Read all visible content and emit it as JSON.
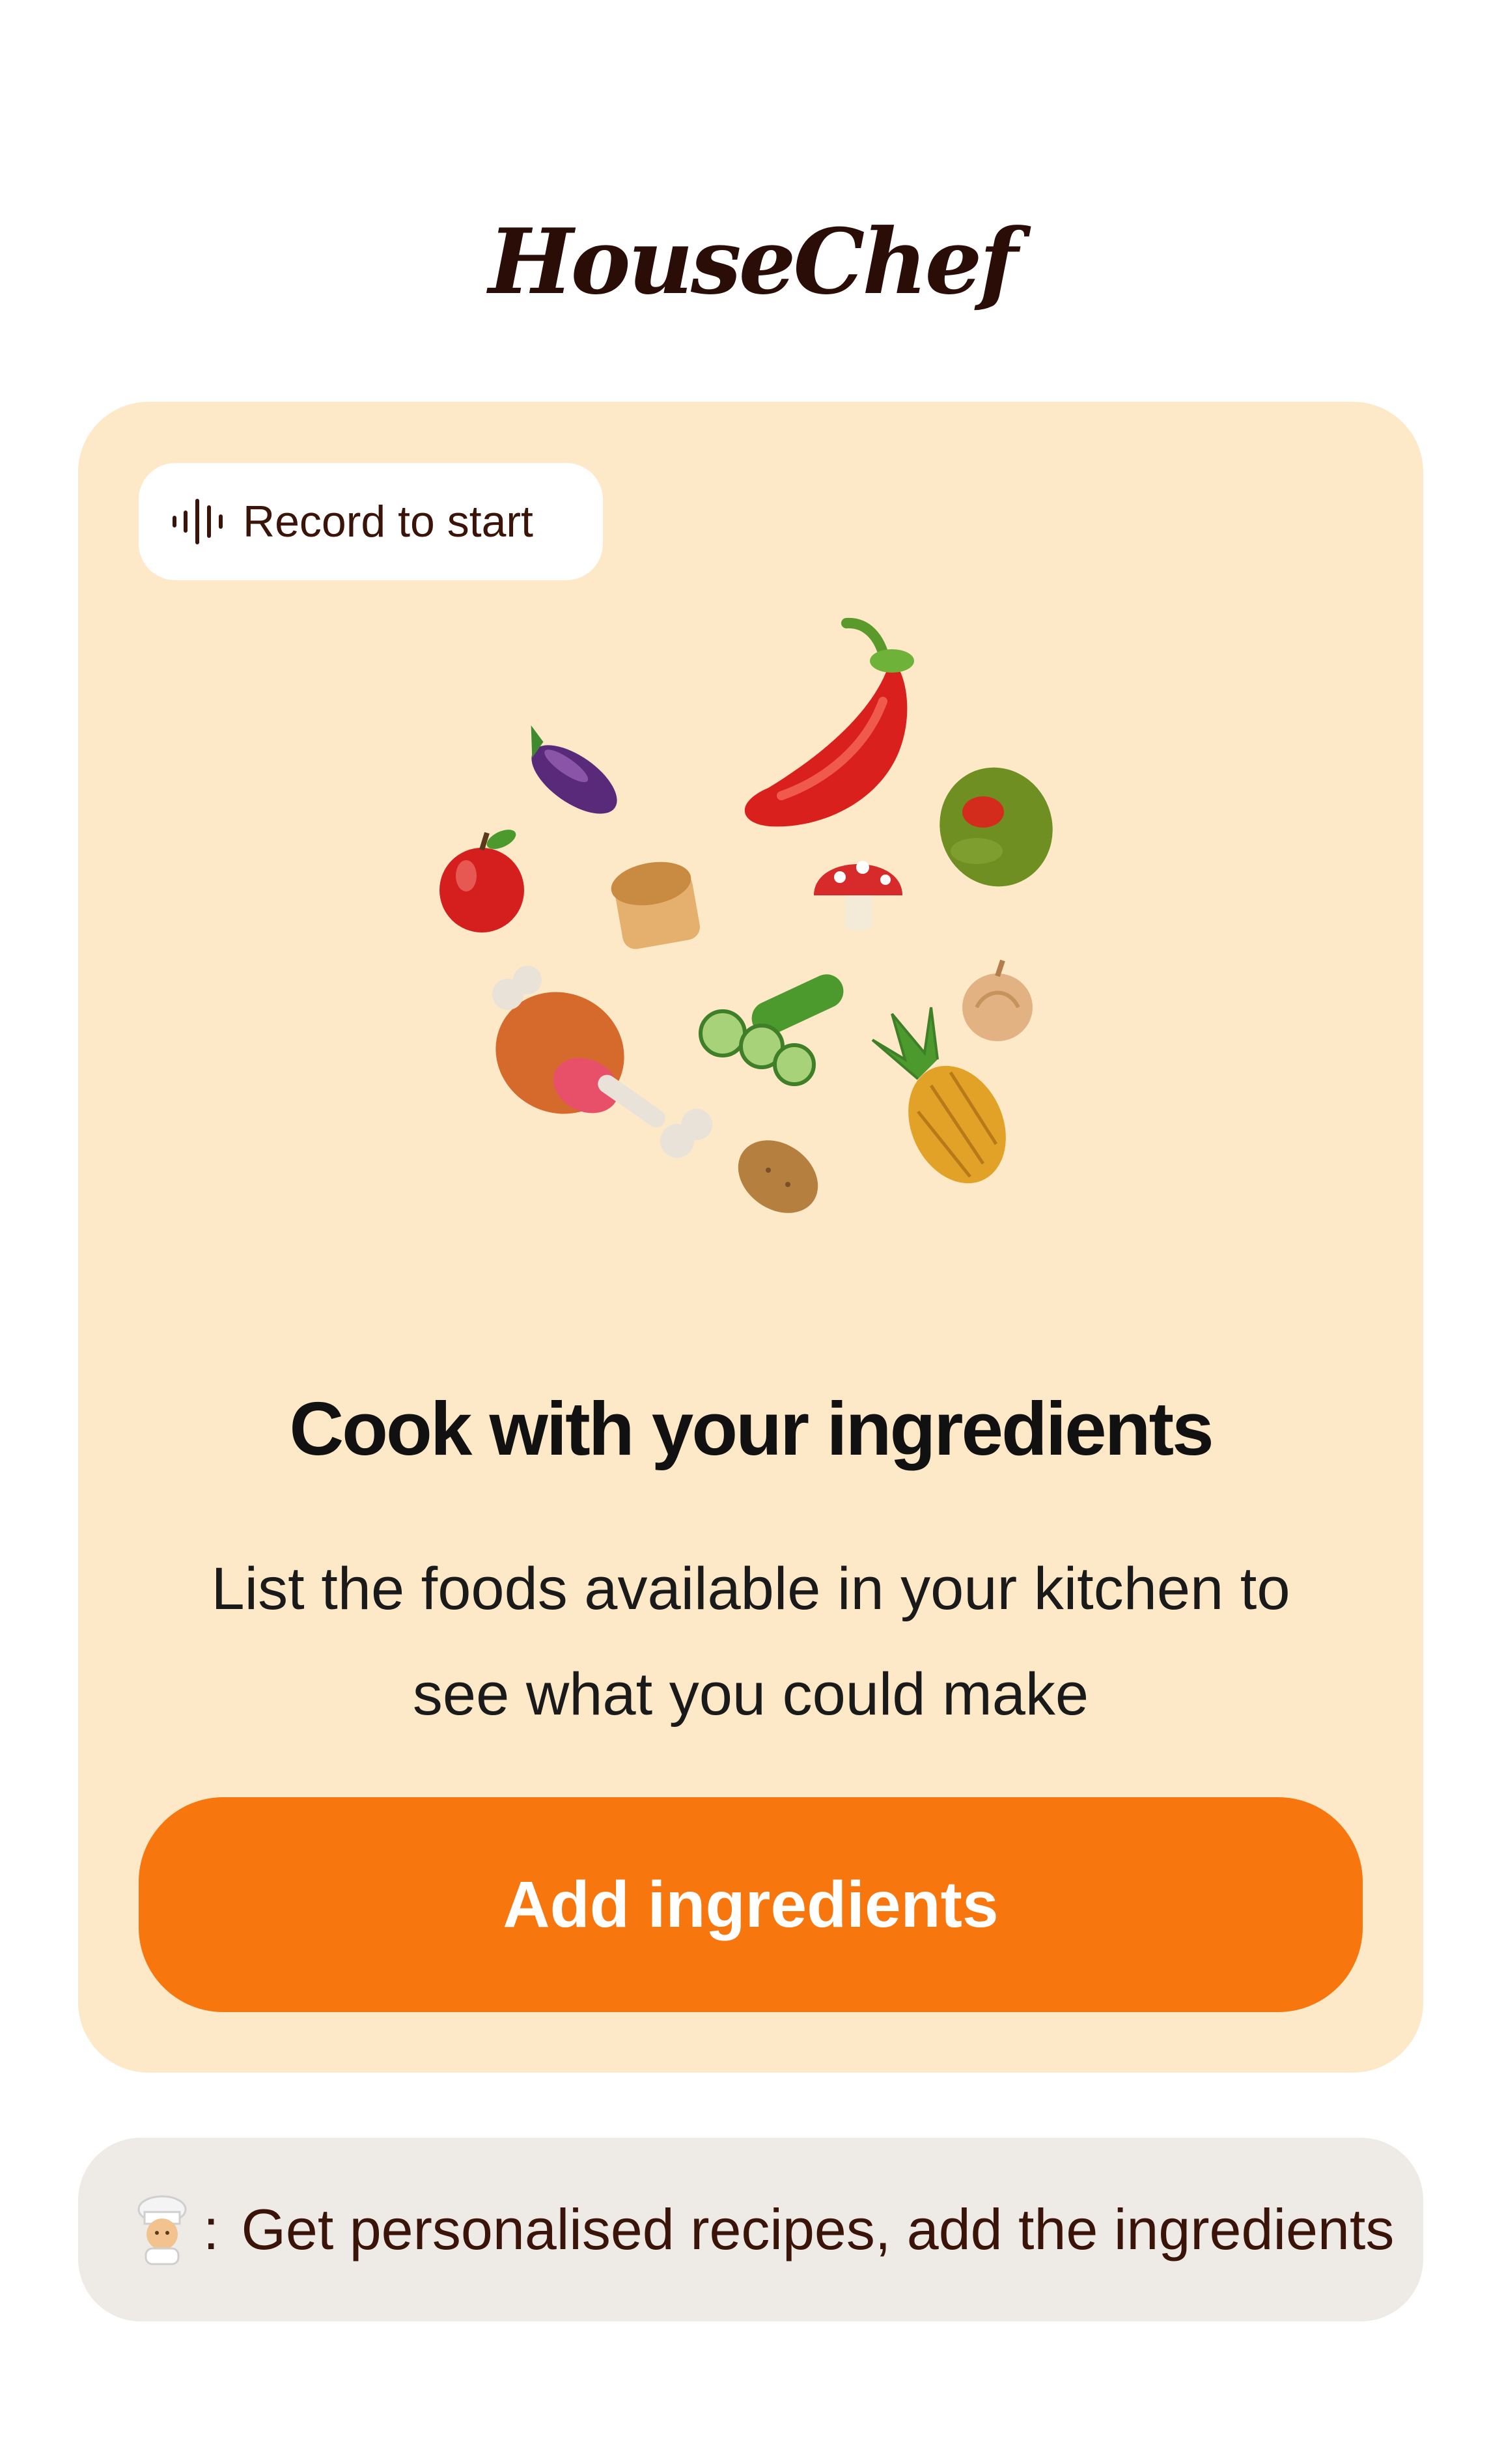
{
  "app": {
    "title": "HouseChef"
  },
  "card": {
    "record_label": "Record to start",
    "heading": "Cook with your ingredients",
    "subtext": "List the foods available in your kitchen to see what you could make",
    "cta_label": "Add ingredients",
    "illustration_items": [
      "chili-pepper",
      "eggplant",
      "olive",
      "apple",
      "bread",
      "mushroom",
      "onion",
      "meat-on-bone",
      "cucumber",
      "pineapple",
      "potato"
    ]
  },
  "hint": {
    "icon": "chef-emoji",
    "separator": ":",
    "text": "Get personalised recipes, add the ingredients"
  },
  "colors": {
    "card_background": "#fde9c7",
    "cta_background": "#f7760e",
    "hint_background": "#eeebe6",
    "text_brown": "#3a1409"
  }
}
